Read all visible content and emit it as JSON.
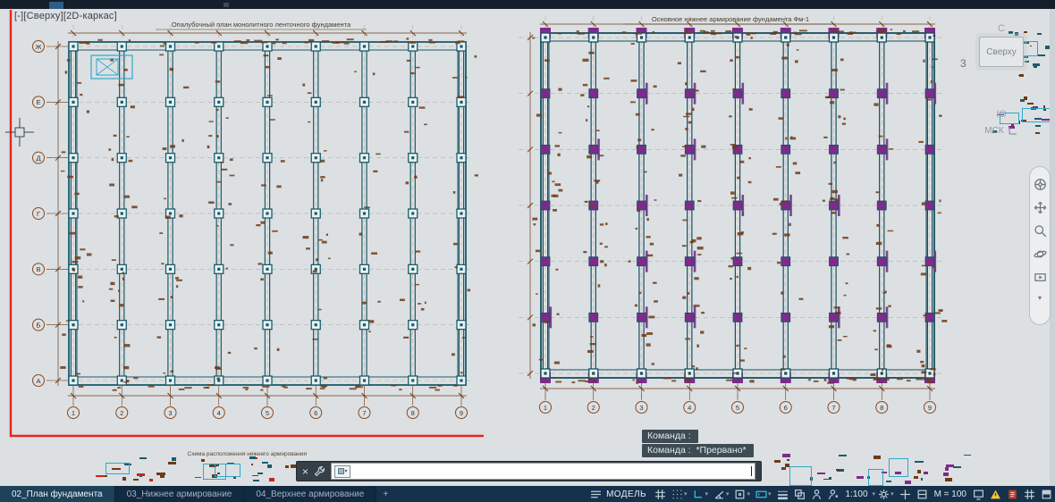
{
  "viewport_controls": "[-][Сверху][2D-каркас]",
  "overlay": {
    "revision_line_color": "#e8241b"
  },
  "plans": {
    "left": {
      "title": "Опалубочный план монолитного ленточного фундамента",
      "cols": 9,
      "rows": 7,
      "seed": 11,
      "scatter": 170,
      "line_color": "#1a5c6a",
      "accent_color": "#2ea8c8",
      "mark_color": "#6e3a17",
      "bubble_color": "#8a4a20",
      "bottom_labels": [
        "1",
        "2",
        "3",
        "4",
        "5",
        "6",
        "7",
        "8",
        "9"
      ],
      "side_labels": [
        "Ж",
        "Е",
        "Д",
        "Г",
        "В",
        "Б",
        "А"
      ],
      "cyan_detail": true,
      "purple_interior": false
    },
    "right": {
      "title": "Основное нижнее армирование фундамента Фм-1",
      "cols": 9,
      "rows": 7,
      "seed": 29,
      "scatter": 240,
      "line_color": "#14505e",
      "accent_color": "#7c2b8c",
      "mark_color": "#6e3a17",
      "bubble_color": "#8a4a20",
      "bottom_labels": [
        "1",
        "2",
        "3",
        "4",
        "5",
        "6",
        "7",
        "8",
        "9"
      ],
      "side_labels": [],
      "cyan_detail": false,
      "purple_interior": true
    },
    "bottom_left_title": "Схема расположения нижнего армирования"
  },
  "viewcube": {
    "north": "С",
    "face": "Сверху",
    "south": "Ю",
    "ucs_label": "МСК",
    "stray_number": "3"
  },
  "command": {
    "history": [
      "Команда :",
      "Команда :  *Прервано*"
    ],
    "input_value": ""
  },
  "file_tabs": [
    {
      "label": "02_План фундамента"
    },
    {
      "label": "03_Нижнее армирование"
    },
    {
      "label": "04_Верхнее армирование"
    }
  ],
  "new_tab_label": "+",
  "status": {
    "model_label": "МОДЕЛЬ",
    "annotation_scale": "1:100",
    "display_scale": "М = 100"
  }
}
